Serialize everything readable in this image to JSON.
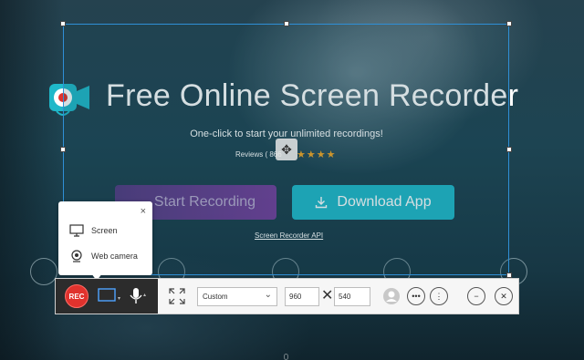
{
  "hero": {
    "title": "Free Online Screen Recorder",
    "subtitle": "One-click to start your unlimited recordings!",
    "reviews": "Reviews ( 866",
    "stars": "★★★★",
    "start_button": "Start Recording",
    "download_button": "Download App",
    "api_link": "Screen Recorder API"
  },
  "popup": {
    "close": "×",
    "items": [
      {
        "label": "Screen",
        "icon": "monitor-icon"
      },
      {
        "label": "Web camera",
        "icon": "webcam-icon"
      }
    ]
  },
  "toolbar": {
    "rec_label": "REC",
    "size_preset": "Custom",
    "width_value": "960",
    "height_value": "540",
    "multiply_sign": "✕"
  },
  "colors": {
    "accent_teal": "#1fb8c9",
    "rec_red": "#e0322d",
    "selection_blue": "#2f8fd6",
    "star_orange": "#f5a623"
  }
}
